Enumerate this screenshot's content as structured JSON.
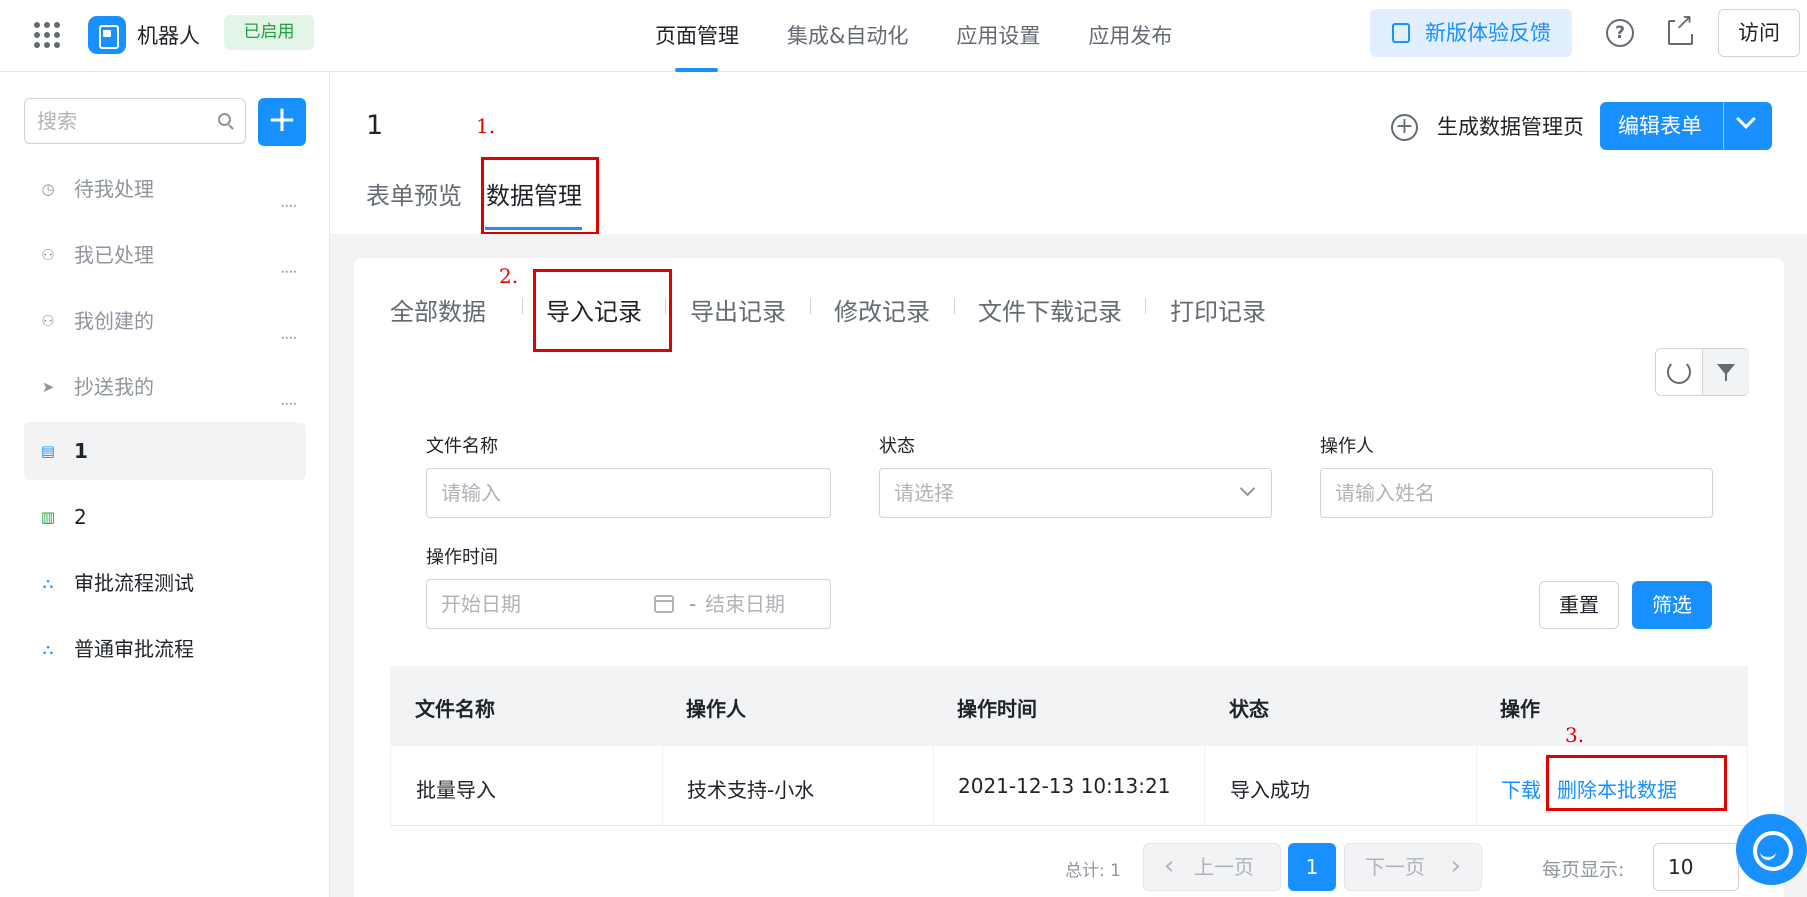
{
  "header": {
    "app_name": "机器人",
    "status_badge": "已启用",
    "nav": [
      "页面管理",
      "集成&自动化",
      "应用设置",
      "应用发布"
    ],
    "feedback": "新版体验反馈",
    "visit": "访问"
  },
  "sidebar": {
    "search_placeholder": "搜索",
    "items": [
      {
        "label": "待我处理",
        "icon": "clock-icon"
      },
      {
        "label": "我已处理",
        "icon": "user-check-icon"
      },
      {
        "label": "我创建的",
        "icon": "user-add-icon"
      },
      {
        "label": "抄送我的",
        "icon": "send-icon"
      },
      {
        "label": "1",
        "icon": "form-doc-icon"
      },
      {
        "label": "2",
        "icon": "report-icon"
      },
      {
        "label": "审批流程测试",
        "icon": "flow-icon"
      },
      {
        "label": "普通审批流程",
        "icon": "flow-icon"
      }
    ]
  },
  "page": {
    "title": "1",
    "generate": "生成数据管理页",
    "edit_form": "编辑表单",
    "tabs": [
      "表单预览",
      "数据管理"
    ]
  },
  "annotations": [
    "1.",
    "2.",
    "3."
  ],
  "subtabs": [
    "全部数据",
    "导入记录",
    "导出记录",
    "修改记录",
    "文件下载记录",
    "打印记录"
  ],
  "filters": {
    "file_name": {
      "label": "文件名称",
      "placeholder": "请输入"
    },
    "status": {
      "label": "状态",
      "placeholder": "请选择"
    },
    "operator": {
      "label": "操作人",
      "placeholder": "请输入姓名"
    },
    "time": {
      "label": "操作时间",
      "start": "开始日期",
      "sep": "-",
      "end": "结束日期"
    },
    "reset": "重置",
    "submit": "筛选"
  },
  "table": {
    "headers": [
      "文件名称",
      "操作人",
      "操作时间",
      "状态",
      "操作"
    ],
    "rows": [
      {
        "file": "批量导入",
        "operator": "技术支持-小水",
        "time": "2021-12-13 10:13:21",
        "status": "导入成功",
        "download": "下载",
        "delete": "删除本批数据"
      }
    ]
  },
  "pager": {
    "total": "总计: 1",
    "prev": "上一页",
    "current": "1",
    "next": "下一页",
    "size_label": "每页显示:",
    "size": "10"
  },
  "colors": {
    "accent": "#1890ff",
    "annotation": "#e00000",
    "success": "#21a047"
  }
}
